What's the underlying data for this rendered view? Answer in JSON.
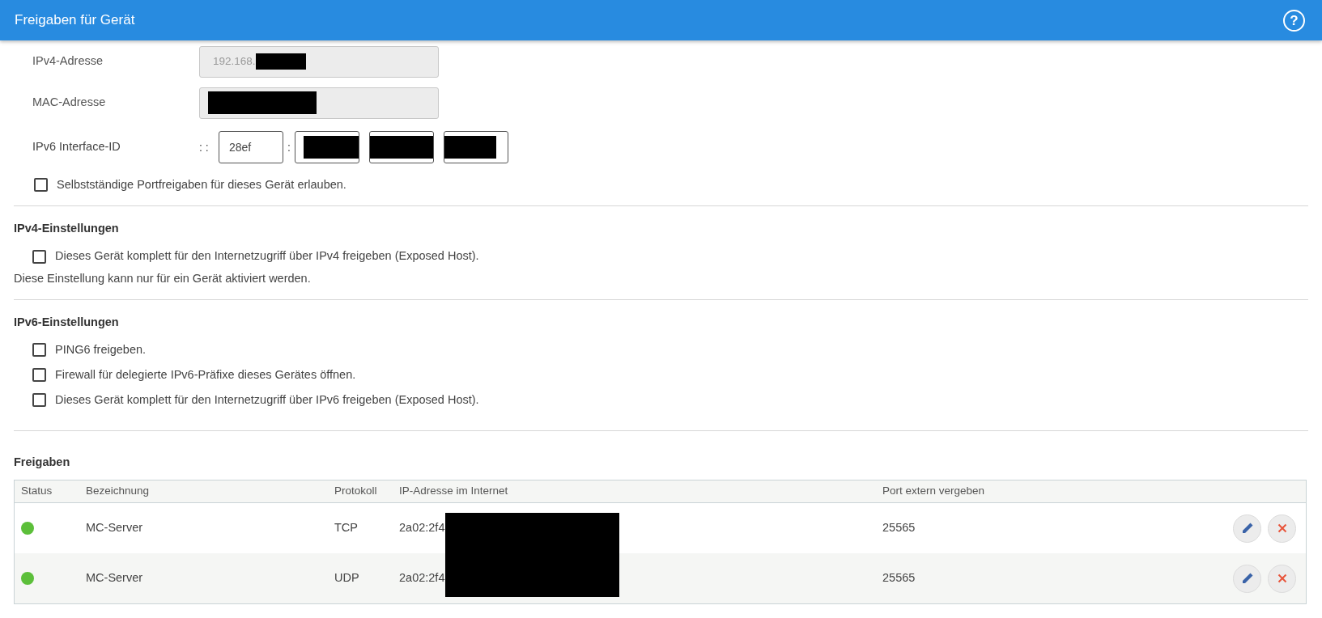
{
  "title": "Freigaben für Gerät",
  "help": "?",
  "device": {
    "ipv4": {
      "label": "IPv4-Adresse",
      "value": "192.168.",
      "redacted": true
    },
    "mac": {
      "label": "MAC-Adresse",
      "redacted": true
    },
    "ipv6": {
      "label": "IPv6 Interface-ID",
      "prefix": ": :",
      "separator": ":",
      "groups": [
        {
          "value": "28ef",
          "redacted": false
        },
        {
          "redacted": true
        },
        {
          "redacted": true
        },
        {
          "redacted": true
        }
      ]
    },
    "options": [
      {
        "label": "Selbstständige Portfreigaben für dieses Gerät erlauben.",
        "checked": false
      }
    ]
  },
  "sections": [
    {
      "heading": "IPv4-Einstellungen",
      "options": [
        {
          "label": "Dieses Gerät komplett für den Internetzugriff über IPv4 freigeben (Exposed Host).",
          "checked": false
        }
      ],
      "note": "Diese Einstellung kann nur für ein Gerät aktiviert werden."
    },
    {
      "heading": "IPv6-Einstellungen",
      "options": [
        {
          "label": "PING6 freigeben.",
          "checked": false
        },
        {
          "label": "Firewall für delegierte IPv6-Präfixe dieses Gerätes öffnen.",
          "checked": false
        },
        {
          "label": "Dieses Gerät komplett für den Internetzugriff über IPv6 freigeben (Exposed Host).",
          "checked": false
        }
      ]
    }
  ],
  "shares": {
    "heading": "Freigaben",
    "columns": [
      "Status",
      "Bezeichnung",
      "Protokoll",
      "IP-Adresse im Internet",
      "Port extern vergeben"
    ],
    "ip_redacted": true,
    "rows": [
      {
        "color": "#5cbf3a",
        "name": "MC-Server",
        "protocol": "TCP",
        "ip": "2a02:2f4",
        "port": "25565"
      },
      {
        "color": "#5cbf3a",
        "name": "MC-Server",
        "protocol": "UDP",
        "ip": "2a02:2f4",
        "port": "25565"
      }
    ]
  }
}
